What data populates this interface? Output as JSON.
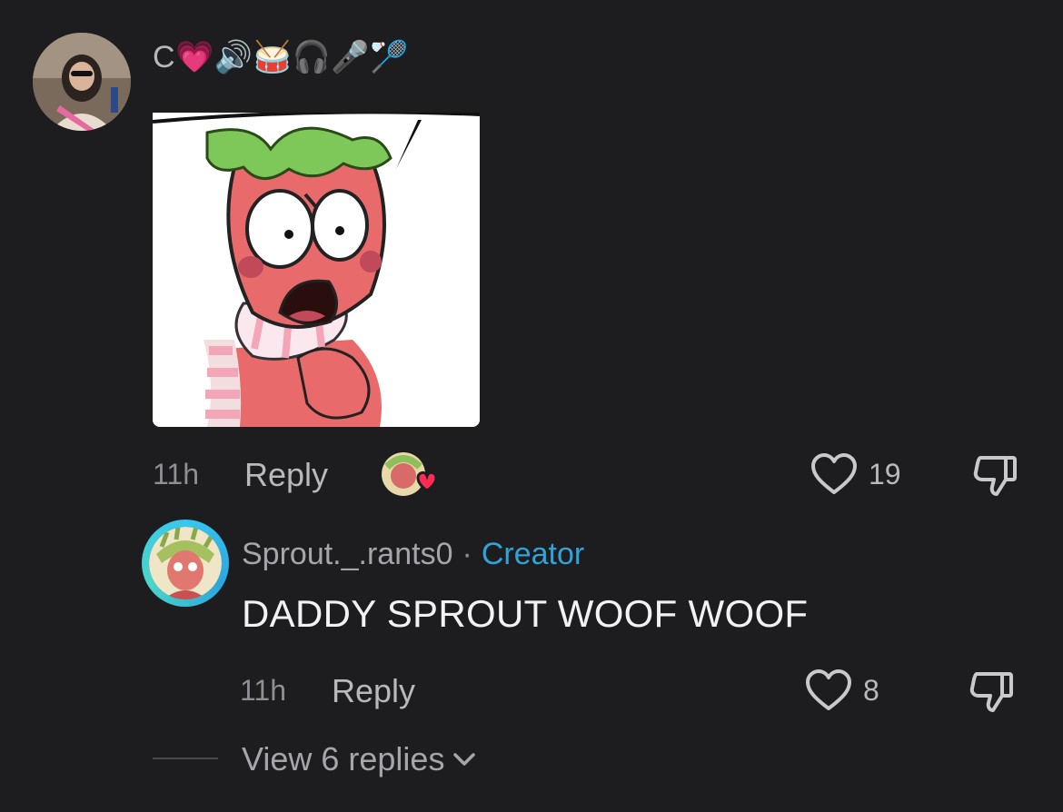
{
  "comment": {
    "username": "C",
    "username_emojis": "💗🔊🥁🎧🎤🏸",
    "time": "11h",
    "reply_label": "Reply",
    "likes": "19",
    "liked_by_creator": true
  },
  "reply": {
    "username": "Sprout._.rants0",
    "separator": "·",
    "badge": "Creator",
    "text": "DADDY SPROUT WOOF WOOF",
    "time": "11h",
    "reply_label": "Reply",
    "likes": "8"
  },
  "view_replies": "View 6 replies",
  "colors": {
    "background": "#1d1d1f",
    "creator_badge": "#2ea4d8",
    "heart_red": "#fe2c55",
    "avatar_ring": "#37c8f0"
  }
}
